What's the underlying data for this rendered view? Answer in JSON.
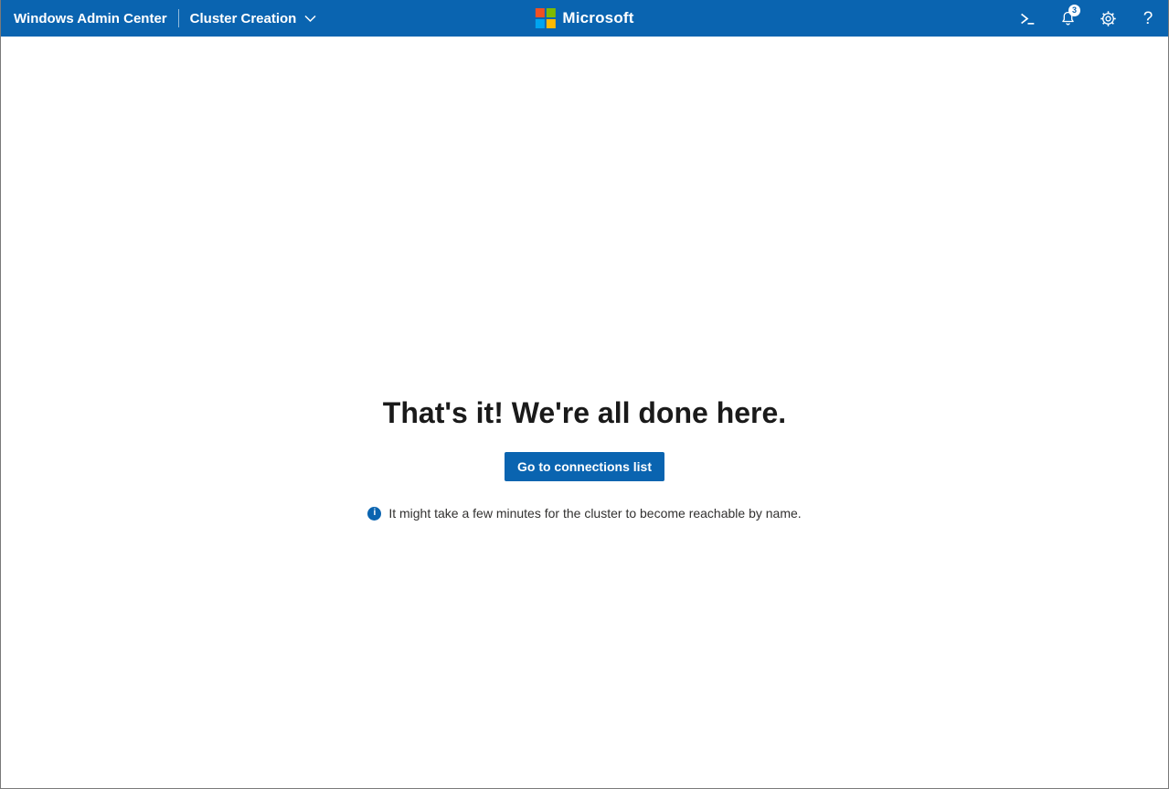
{
  "topbar": {
    "app_title": "Windows Admin Center",
    "solution_title": "Cluster Creation",
    "brand": "Microsoft",
    "notifications": {
      "count": "3"
    },
    "help_glyph": "?",
    "icons": {
      "powershell": "powershell-prompt",
      "notifications": "bell",
      "settings": "gear",
      "help": "question-mark",
      "solution_dropdown": "chevron-down"
    }
  },
  "main": {
    "heading": "That's it! We're all done here.",
    "primary_button_label": "Go to connections list",
    "info_text": "It might take a few minutes for the cluster to become reachable by name."
  },
  "colors": {
    "topbar_bg": "#0a64b0",
    "primary_button_bg": "#0a64b0",
    "heading_text": "#1a1a1a",
    "body_text": "#323130",
    "badge_bg": "#ffffff",
    "badge_text": "#0a64b0",
    "ms_logo_squares": [
      "#f25022",
      "#7fba00",
      "#00a4ef",
      "#ffb900"
    ]
  }
}
